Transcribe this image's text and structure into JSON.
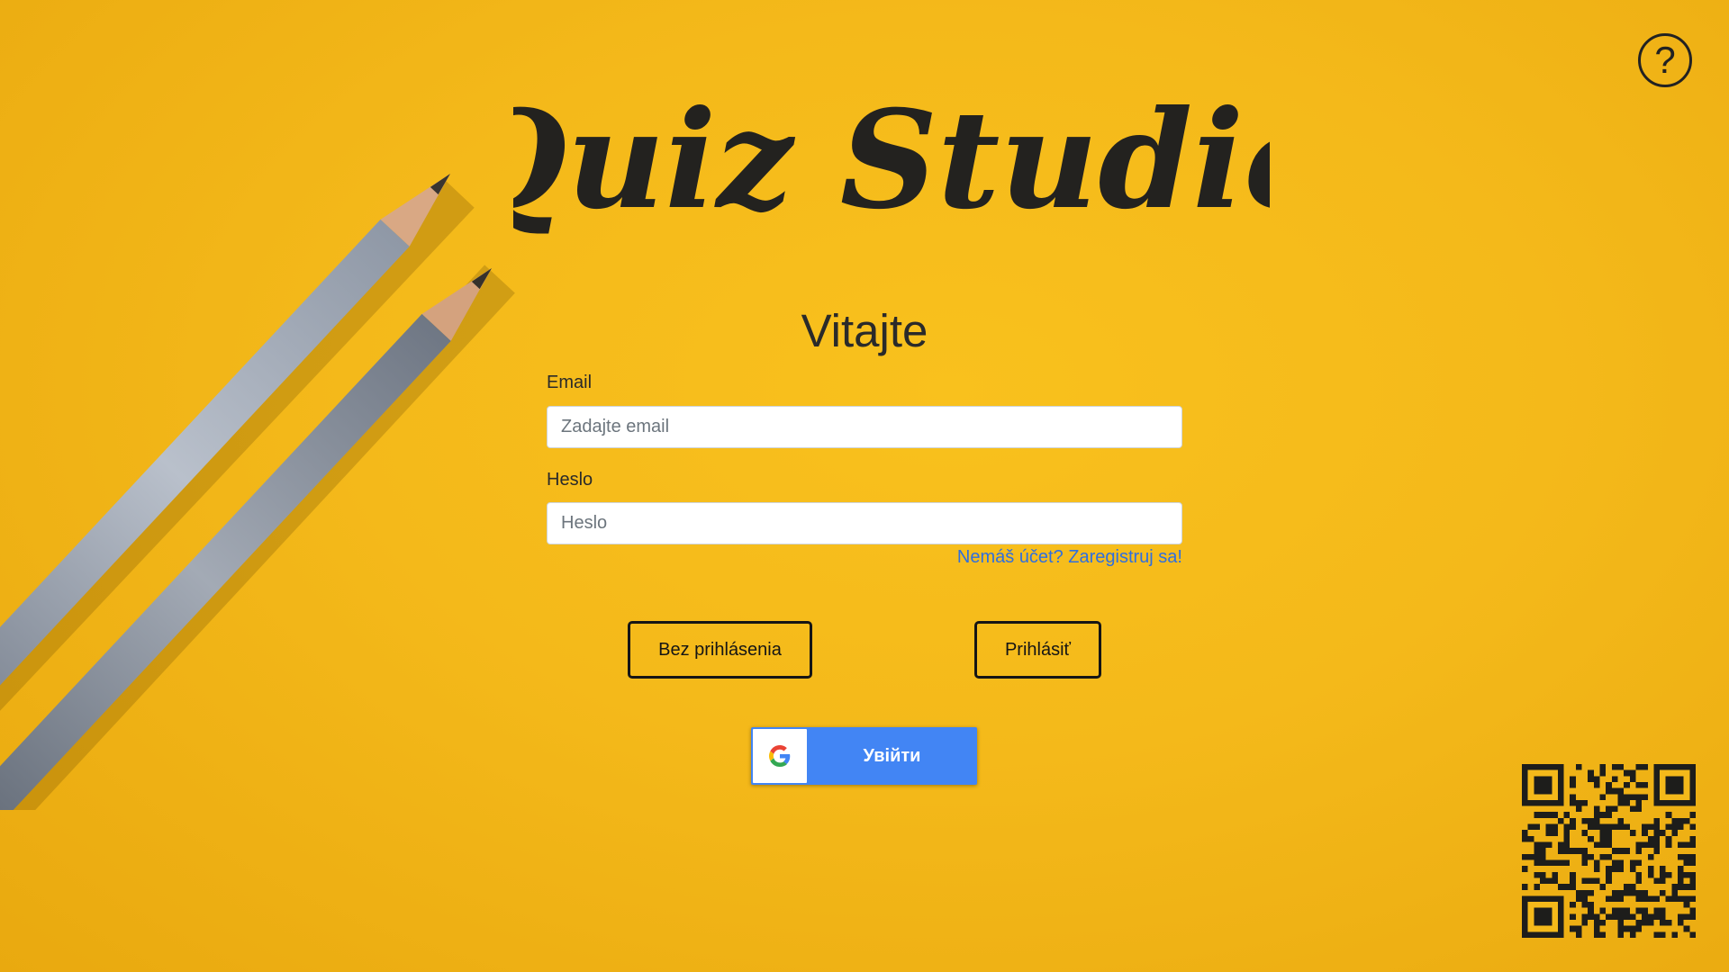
{
  "app": {
    "title": "Quiz Studio"
  },
  "help": {
    "label": "?"
  },
  "login": {
    "heading": "Vitajte",
    "email_label": "Email",
    "email_value": "",
    "email_placeholder": "Zadajte email",
    "password_label": "Heslo",
    "password_value": "",
    "password_placeholder": "Heslo",
    "register_link": "Nemáš účet? Zaregistruj sa!",
    "guest_button": "Bez prihlásenia",
    "login_button": "Prihlásiť",
    "google_button": "Увійти"
  },
  "icons": {
    "help": "question-circle-icon",
    "google": "google-g-icon",
    "qr": "qr-code"
  },
  "colors": {
    "background": "#f4b91a",
    "text": "#23221f",
    "link": "#2f6fe0",
    "google_blue": "#4285f4"
  }
}
